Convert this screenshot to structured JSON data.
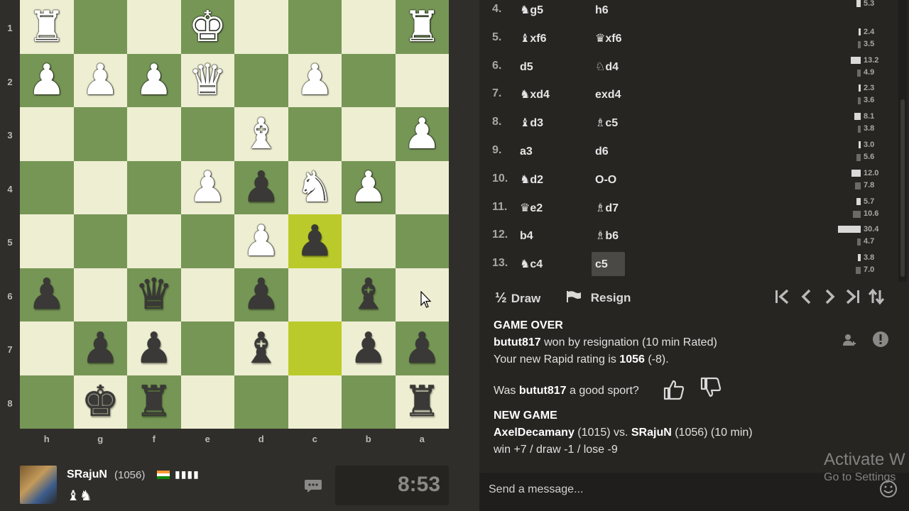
{
  "board": {
    "ranks": [
      "1",
      "2",
      "3",
      "4",
      "5",
      "6",
      "7",
      "8"
    ],
    "files": [
      "h",
      "g",
      "f",
      "e",
      "d",
      "c",
      "b",
      "a"
    ],
    "squares": [
      [
        "♜w",
        "",
        "",
        "♚w",
        "",
        "",
        "",
        "♜w"
      ],
      [
        "♟w",
        "♟w",
        "♟w",
        "♛w",
        "",
        "♟w",
        "",
        ""
      ],
      [
        "",
        "",
        "",
        "",
        "♝w",
        "",
        "",
        "♟w"
      ],
      [
        "",
        "",
        "",
        "♟w",
        "♟b",
        "♞w",
        "♟w",
        ""
      ],
      [
        "",
        "",
        "",
        "",
        "♟w",
        "♟b",
        "",
        ""
      ],
      [
        "♟b",
        "",
        "♛b",
        "",
        "♟b",
        "",
        "♝b",
        ""
      ],
      [
        "",
        "♟b",
        "♟b",
        "",
        "♝b",
        "",
        "♟b",
        "♟b"
      ],
      [
        "",
        "♚b",
        "♜b",
        "",
        "",
        "",
        "",
        "♜b"
      ]
    ],
    "highlighted": [
      [
        4,
        5
      ],
      [
        6,
        5
      ]
    ]
  },
  "player": {
    "name": "SRajuN",
    "rating": "(1056)",
    "bars": "▮▮▮▮",
    "captured": "♝♞",
    "chat_icon": "chat-bubble-icon",
    "clock": "8:53"
  },
  "moves": [
    {
      "num": "4.",
      "w_fig": "♞",
      "w": "g5",
      "b_fig": "",
      "b": "h6",
      "t1": "5.3",
      "t1_note": "2.4"
    },
    {
      "num": "5.",
      "w_fig": "♝",
      "w": "xf6",
      "b_fig": "♛",
      "b": "xf6",
      "t1": "2.4",
      "t2": "3.5"
    },
    {
      "num": "6.",
      "w_fig": "",
      "w": "d5",
      "b_fig": "♘",
      "b": "d4",
      "t1": "13.2",
      "t2": "4.9"
    },
    {
      "num": "7.",
      "w_fig": "♞",
      "w": "xd4",
      "b_fig": "",
      "b": "exd4",
      "t1": "2.3",
      "t2": "3.6"
    },
    {
      "num": "8.",
      "w_fig": "♝",
      "w": "d3",
      "b_fig": "♗",
      "b": "c5",
      "t1": "8.1",
      "t2": "3.8"
    },
    {
      "num": "9.",
      "w_fig": "",
      "w": "a3",
      "b_fig": "",
      "b": "d6",
      "t1": "3.0",
      "t2": "5.6"
    },
    {
      "num": "10.",
      "w_fig": "♞",
      "w": "d2",
      "b_fig": "",
      "b": "O-O",
      "t1": "12.0",
      "t2": "7.8"
    },
    {
      "num": "11.",
      "w_fig": "♛",
      "w": "e2",
      "b_fig": "♗",
      "b": "d7",
      "t1": "5.7",
      "t2": "10.6"
    },
    {
      "num": "12.",
      "w_fig": "",
      "w": "b4",
      "b_fig": "♗",
      "b": "b6",
      "t1": "30.4",
      "t2": "4.7"
    },
    {
      "num": "13.",
      "w_fig": "♞",
      "w": "c4",
      "b_fig": "",
      "b": "c5",
      "t1": "3.8",
      "t2": "7.0"
    }
  ],
  "controls": {
    "draw_icon": "½",
    "draw_label": "Draw",
    "resign_label": "Resign",
    "resign_icon": "flag-icon"
  },
  "game_info": {
    "heading": "GAME OVER",
    "winner": "butut817",
    "result_text": " won by resignation (10 min Rated)",
    "rating_prefix": "Your new Rapid rating is ",
    "rating_value": "1056",
    "rating_suffix": " (-8).",
    "sport_prefix": "Was ",
    "sport_name": "butut817",
    "sport_suffix": " a good sport?",
    "new_game_heading": "NEW GAME",
    "ng_white": "AxelDecamany",
    "ng_white_rating": " (1015) vs. ",
    "ng_black": "SRajuN",
    "ng_black_rating": " (1056) (10 min)",
    "ng_odds": "win +7 / draw -1 / lose -9"
  },
  "message": {
    "placeholder": "Send a message..."
  },
  "watermark": {
    "line1": "Activate W",
    "line2": "Go to Settings"
  }
}
